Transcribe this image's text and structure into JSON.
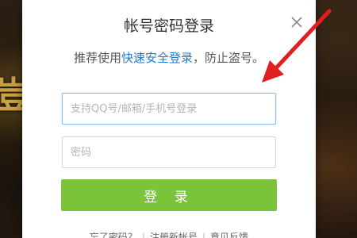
{
  "background": {
    "glyph": "豈"
  },
  "dialog": {
    "title": "帐号密码登录",
    "close_icon": "close-icon",
    "subtitle": {
      "prefix": "推荐使用",
      "link": "快速安全登录",
      "suffix": "，防止盗号。"
    },
    "username": {
      "value": "",
      "placeholder": "支持QQ号/邮箱/手机号登录"
    },
    "password": {
      "value": "",
      "placeholder": "密码"
    },
    "login_label": "登 录",
    "footer": {
      "forgot": "忘了密码？",
      "register": "注册新帐号",
      "feedback": "意见反馈"
    }
  },
  "colors": {
    "accent_green": "#7ac33b",
    "link_blue": "#1e7bd6",
    "arrow_red": "#e02020"
  }
}
